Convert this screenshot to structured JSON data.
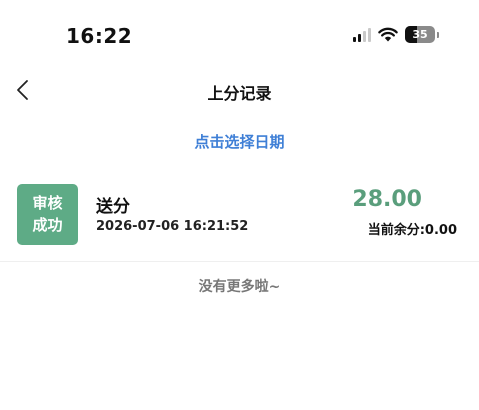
{
  "status_bar": {
    "time": "16:22",
    "battery_level": "35"
  },
  "nav": {
    "title": "上分记录"
  },
  "filter": {
    "date_picker_label": "点击选择日期"
  },
  "records": [
    {
      "status_line1": "审核",
      "status_line2": "成功",
      "title": "送分",
      "datetime": "2026-07-06 16:21:52",
      "amount": "28.00",
      "balance": "当前余分:0.00"
    }
  ],
  "footer": {
    "no_more_text": "没有更多啦~"
  },
  "colors": {
    "accent_blue": "#3f7fd6",
    "success_green": "#5eab86",
    "amount_green": "#5a9e7c"
  }
}
